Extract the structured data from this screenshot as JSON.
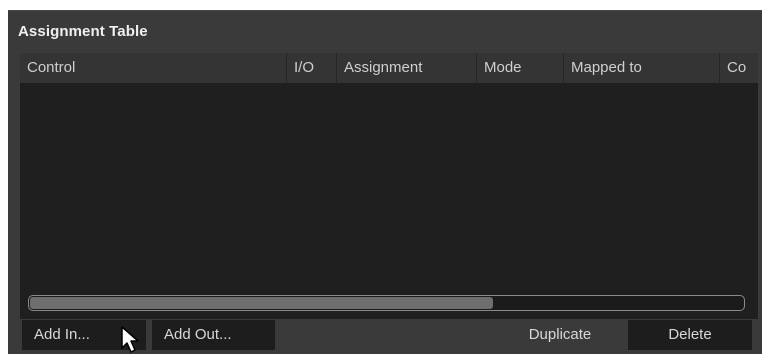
{
  "panel": {
    "title": "Assignment Table"
  },
  "table": {
    "columns": [
      {
        "label": "Control"
      },
      {
        "label": "I/O"
      },
      {
        "label": "Assignment"
      },
      {
        "label": "Mode"
      },
      {
        "label": "Mapped to"
      },
      {
        "label": "Co"
      }
    ],
    "rows": []
  },
  "scrollbar": {
    "horizontal_position_fraction": 0.0,
    "horizontal_visible_fraction": 0.65
  },
  "buttons": {
    "add_in": "Add In...",
    "add_out": "Add Out...",
    "duplicate": "Duplicate",
    "delete": "Delete"
  },
  "icons": {
    "cursor": "mouse-pointer-icon"
  },
  "colors": {
    "panel_bg": "#3a3a3a",
    "table_bg": "#1f1f1f",
    "header_bg": "#343434",
    "button_bg": "#1d1d1d",
    "text": "#d8d8d8"
  }
}
